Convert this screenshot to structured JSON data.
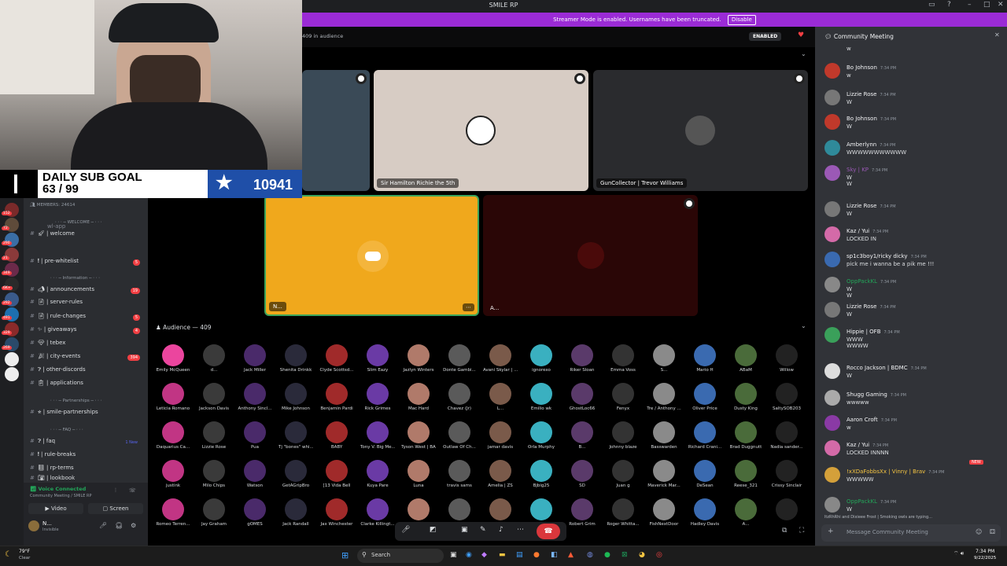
{
  "window": {
    "title": "SMILE RP"
  },
  "banner": {
    "text": "Streamer Mode is enabled. Usernames have been truncated.",
    "disable": "Disable"
  },
  "stage": {
    "audience_count": "409 in audience",
    "enabled_badge": "ENABLED",
    "tiles": [
      "Sir Hamilton Richie the 5th",
      "GunCollector | Trevor Williams",
      "N...",
      "A..."
    ]
  },
  "subgoal": {
    "title": "DAILY SUB GOAL",
    "progress": "63 / 99",
    "count": "10941"
  },
  "sidebar": {
    "members": "MEMBERS: 24614",
    "server_badges": [
      "152",
      "72",
      "290",
      "21",
      "349",
      "6K+",
      "292",
      "491",
      "329",
      "269"
    ],
    "categories": {
      "welcome": "WELCOME",
      "information": "Information",
      "partnerships": "Partnerships",
      "faq": "FAQ"
    },
    "channels": [
      {
        "name": "wl-app",
        "badge": ""
      },
      {
        "name": "welcome",
        "badge": ""
      },
      {
        "name": "pre-whitelist",
        "badge": "5"
      },
      {
        "name": "announcements",
        "badge": "19"
      },
      {
        "name": "server-rules",
        "badge": ""
      },
      {
        "name": "rule-changes",
        "badge": "5"
      },
      {
        "name": "giveaways",
        "badge": "4"
      },
      {
        "name": "tebex",
        "badge": ""
      },
      {
        "name": "city-events",
        "badge": "394"
      },
      {
        "name": "other-discords",
        "badge": ""
      },
      {
        "name": "applications",
        "badge": ""
      },
      {
        "name": "smile-partnerships",
        "badge": ""
      },
      {
        "name": "faq",
        "badge": "1 New"
      },
      {
        "name": "rule-breaks",
        "badge": ""
      },
      {
        "name": "rp-terms",
        "badge": ""
      },
      {
        "name": "lookbook",
        "badge": ""
      }
    ],
    "voice": {
      "status": "Voice Connected",
      "where": "Community Meeting / SMILE RP",
      "video": "Video",
      "screen": "Screen"
    },
    "user": {
      "name": "N...",
      "status": "Invisible"
    }
  },
  "audience": {
    "header": "Audience — 409",
    "members": [
      "Emily McQueen",
      "d...",
      "Jack Miller",
      "Shenita Drinkk",
      "Clyde Scottsd...",
      "Slim Eazy",
      "Jazlyn Winters",
      "Donte Gambi...",
      "Avani Skylar | ...",
      "ignorexo",
      "Riker Sloan",
      "Emma Voss",
      "S...",
      "Mario H",
      "ABaM",
      "Willow",
      "Leticia Romano",
      "Jackson Davis",
      "Anthony Sincl...",
      "Mike Johnson",
      "Benjamin Pardi",
      "Rick Grimes",
      "Mac Hard",
      "Chavez (Jr)",
      "L...",
      "Emilio wk",
      "GhostLoc66",
      "Fenyx",
      "Tre / Anthony ...",
      "Oliver Price",
      "Dusty King",
      "SaltySOB203",
      "Daquarius Ca...",
      "Lizzie Rose",
      "Pua",
      "Tj \"bones\" whi...",
      "BABY",
      "Tony V. Big Me...",
      "Tyson West | BA",
      "Outlaw Of Ch...",
      "jamar davis",
      "Orla Murphy",
      "B...",
      "Johnny blaze",
      "Basswarden",
      "Richard Crani...",
      "Brad Duggnutt",
      "Nadia sander...",
      "justink",
      "Milo Chips",
      "Watson",
      "GetAGripBro",
      "[13 Vida Bell",
      "Kuya Pare",
      "Luna",
      "travis sams",
      "Amelia | ZS",
      "Bjbig25",
      "SD",
      "Juan g",
      "Maverick Mar...",
      "DeSean",
      "Reese_321",
      "Crissy Sinclair",
      "Romeo Terren...",
      "Jay Graham",
      "gOMES",
      "Jack Randall",
      "Jax Winchester",
      "Clarke Killingt...",
      "Ian Cre...",
      "...",
      "...",
      "...",
      "Robert Grim",
      "Roger Whitta...",
      "FishNextDoor",
      "Hadley Davis",
      "A...",
      ""
    ]
  },
  "chat": {
    "title": "Community Meeting",
    "input_placeholder": "Message Community Meeting",
    "typing": "ltzRhRhi and Dixieee Frost | Smoking owls are typing...",
    "messages": [
      {
        "user": "",
        "time": "",
        "text": "w"
      },
      {
        "user": "Bo Johnson",
        "time": "7:34 PM",
        "text": "w"
      },
      {
        "user": "Lizzie Rose",
        "time": "7:34 PM",
        "text": "W"
      },
      {
        "user": "Bo Johnson",
        "time": "7:34 PM",
        "text": "W"
      },
      {
        "user": "Amberlynn",
        "time": "7:34 PM",
        "text": "WWWWWWWWWWW"
      },
      {
        "user": "Sky | KP",
        "time": "7:34 PM",
        "text": "W\nW"
      },
      {
        "user": "Lizzie Rose",
        "time": "7:34 PM",
        "text": "W"
      },
      {
        "user": "Kaz / Yui",
        "time": "7:34 PM",
        "text": "LOCKED IN"
      },
      {
        "user": "sp1c3boy1/ricky dicky",
        "time": "7:34 PM",
        "text": "pick me i wanna be a pik me !!!"
      },
      {
        "user": "OppPackKL",
        "time": "7:34 PM",
        "text": "W\nW"
      },
      {
        "user": "Lizzie Rose",
        "time": "7:34 PM",
        "text": "W"
      },
      {
        "user": "Hippie | OFB",
        "time": "7:34 PM",
        "text": "WWW\nWWWW"
      },
      {
        "user": "Rocco Jackson | BDMC",
        "time": "7:34 PM",
        "text": "W"
      },
      {
        "user": "Shugg Gaming",
        "time": "7:34 PM",
        "text": "wwwww"
      },
      {
        "user": "Aaron Croft",
        "time": "7:34 PM",
        "text": "w"
      },
      {
        "user": "Kaz / Yui",
        "time": "7:34 PM",
        "text": "LOCKED INNNN"
      },
      {
        "user": "!xXDaFobbsXx | Vinny | Brav",
        "time": "7:34 PM",
        "text": "WWWWW"
      },
      {
        "user": "OppPackKL",
        "time": "7:34 PM",
        "text": "W"
      }
    ],
    "new_label": "NEW"
  },
  "taskbar": {
    "weather_temp": "79°F",
    "weather_desc": "Clear",
    "search": "Search",
    "time": "7:34 PM",
    "date": "9/22/2025"
  },
  "colors": {
    "accent": "#5865f2",
    "banner": "#9b2bd6",
    "tile_orange": "#f0a81c",
    "tile_red": "#2a0606",
    "chat_bg": "#313338",
    "green": "#23a559"
  }
}
